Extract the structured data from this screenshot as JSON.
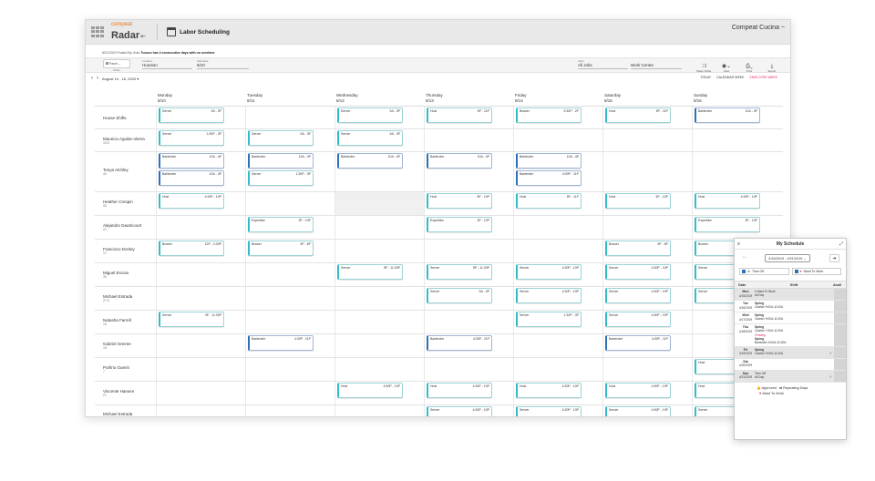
{
  "app": {
    "brand": "compeat",
    "product": "Radar",
    "page_title": "Labor Scheduling",
    "company": "Compeat Cucina ~"
  },
  "notice": {
    "prefix": "8/21/2020 Posted By: Auto",
    "text": "Tucson has 4 consecutive days with no overtime"
  },
  "filters": {
    "view_label": "Panel",
    "mode_label": "Mode",
    "location_label": "Location",
    "location_value": "Houston",
    "schedule_label": "Schedule",
    "schedule_value": "8/10",
    "jobs_label": "Jobs",
    "jobs_value": "All Jobs",
    "workcenter_value": "Work Center",
    "tools": [
      "Share Shifts",
      "View",
      "Print",
      "Export"
    ]
  },
  "datenav": {
    "range": "August 10 - 16, 2020",
    "today": "TODAY",
    "calendar_week": "CALENDAR WEEK",
    "employee_week": "EMPLOYEE WEEK"
  },
  "days": [
    {
      "name": "Monday",
      "date": "8/10"
    },
    {
      "name": "Tuesday",
      "date": "8/11"
    },
    {
      "name": "Wednesday",
      "date": "8/12"
    },
    {
      "name": "Thursday",
      "date": "8/13"
    },
    {
      "name": "Friday",
      "date": "8/14"
    },
    {
      "name": "Saturday",
      "date": "8/15"
    },
    {
      "name": "Sunday",
      "date": "8/16"
    }
  ],
  "rows": [
    {
      "name": "House Shifts",
      "sub": "",
      "h": 25,
      "cells": [
        [
          {
            "job": "Server",
            "time": "9A - 3P",
            "c": "teal"
          }
        ],
        [],
        [
          {
            "job": "Server",
            "time": "9A - 3P",
            "c": "teal"
          }
        ],
        [
          {
            "job": "Host",
            "time": "5P - 11P",
            "c": "teal"
          }
        ],
        [
          {
            "job": "Busser",
            "time": "5:30P - 2P",
            "c": "teal"
          }
        ],
        [
          {
            "job": "Host",
            "time": "5P - 11P",
            "c": "teal"
          }
        ],
        [
          {
            "job": "Bartender",
            "time": "10A - 4P",
            "c": "blue"
          }
        ]
      ]
    },
    {
      "name": "Mauricio Aguilar-olvera",
      "sub": "15.5",
      "h": 25,
      "cells": [
        [
          {
            "job": "Server",
            "time": "1:30P - 3P",
            "c": "teal"
          }
        ],
        [
          {
            "job": "Server",
            "time": "5A - 3P",
            "c": "teal"
          }
        ],
        [
          {
            "job": "Server",
            "time": "9A - 3P",
            "c": "teal"
          }
        ],
        [],
        [],
        [],
        []
      ]
    },
    {
      "name": "Tonya Atchley",
      "sub": "40",
      "h": 44,
      "cells": [
        [
          {
            "job": "Bartender",
            "time": "10A - 4P",
            "c": "blue"
          },
          {
            "job": "Bartender",
            "time": "10A - 4P",
            "c": "blue"
          }
        ],
        [
          {
            "job": "Bartender",
            "time": "10A - 4P",
            "c": "blue"
          },
          {
            "job": "Server",
            "time": "1:30P - 3P",
            "c": "teal"
          }
        ],
        [
          {
            "job": "Bartender",
            "time": "10A - 4P",
            "c": "blue"
          }
        ],
        [
          {
            "job": "Bartender",
            "time": "10A - 4P",
            "c": "blue"
          }
        ],
        [
          {
            "job": "Bartender",
            "time": "10A - 4P",
            "c": "blue"
          },
          {
            "job": "Bartender",
            "time": "4:00P - 11P",
            "c": "blue"
          }
        ],
        [],
        []
      ]
    },
    {
      "name": "Heather Crespin",
      "sub": "30",
      "h": 26,
      "cells": [
        [
          {
            "job": "Host",
            "time": "4:30P - 10P",
            "c": "teal"
          }
        ],
        [],
        [],
        [
          {
            "job": "Host",
            "time": "5P - 10P",
            "c": "teal"
          }
        ],
        [
          {
            "job": "Host",
            "time": "5P - 11P",
            "c": "teal"
          }
        ],
        [
          {
            "job": "Host",
            "time": "5P - 10P",
            "c": "teal"
          }
        ],
        [
          {
            "job": "Host",
            "time": "4:30P - 10P",
            "c": "teal"
          }
        ]
      ],
      "grey": [
        2
      ]
    },
    {
      "name": "Alejandro Dautricourt",
      "sub": "21",
      "h": 26,
      "cells": [
        [],
        [
          {
            "job": "Expeditor",
            "time": "3P - 10P",
            "c": "teal"
          }
        ],
        [],
        [
          {
            "job": "Expeditor",
            "time": "3P - 10P",
            "c": "teal"
          }
        ],
        [],
        [],
        [
          {
            "job": "Expeditor",
            "time": "3P - 10P",
            "c": "teal"
          }
        ]
      ]
    },
    {
      "name": "Francisco Donley",
      "sub": "17",
      "h": 26,
      "cells": [
        [
          {
            "job": "Busser",
            "time": "12P - 2:30P",
            "c": "teal"
          }
        ],
        [
          {
            "job": "Busser",
            "time": "3P - 6P",
            "c": "teal"
          }
        ],
        [],
        [],
        [],
        [
          {
            "job": "Busser",
            "time": "3P - 6P",
            "c": "teal"
          }
        ],
        [
          {
            "job": "Busser",
            "time": "",
            "c": "teal"
          }
        ]
      ]
    },
    {
      "name": "Miguel Escoto",
      "sub": "30",
      "h": 26,
      "cells": [
        [],
        [],
        [
          {
            "job": "Server",
            "time": "5P - 11:30P",
            "c": "teal"
          }
        ],
        [
          {
            "job": "Server",
            "time": "5P - 11:30P",
            "c": "teal"
          }
        ],
        [
          {
            "job": "Server",
            "time": "4:30P - 10P",
            "c": "teal"
          }
        ],
        [
          {
            "job": "Server",
            "time": "4:30P - 10P",
            "c": "teal"
          }
        ],
        [
          {
            "job": "Server",
            "time": "",
            "c": "teal"
          }
        ]
      ]
    },
    {
      "name": "Michael Estrada",
      "sub": "27.5",
      "h": 26,
      "cells": [
        [],
        [],
        [],
        [
          {
            "job": "Server",
            "time": "9A - 3P",
            "c": "teal"
          }
        ],
        [
          {
            "job": "Server",
            "time": "4:30P - 10P",
            "c": "teal"
          }
        ],
        [
          {
            "job": "Server",
            "time": "4:30P - 10P",
            "c": "teal"
          }
        ],
        [
          {
            "job": "Server",
            "time": "",
            "c": "teal"
          }
        ]
      ]
    },
    {
      "name": "Natasha Farrell",
      "sub": "16",
      "h": 26,
      "cells": [
        [
          {
            "job": "Server",
            "time": "3P - 11:30P",
            "c": "teal"
          }
        ],
        [],
        [],
        [],
        [
          {
            "job": "Server",
            "time": "1:30P - 3P",
            "c": "teal"
          }
        ],
        [
          {
            "job": "Server",
            "time": "4:30P - 10P",
            "c": "teal"
          }
        ],
        []
      ]
    },
    {
      "name": "Gabriel Greene",
      "sub": "19",
      "h": 26,
      "cells": [
        [],
        [
          {
            "job": "Bartender",
            "time": "4:30P - 11P",
            "c": "blue"
          }
        ],
        [],
        [
          {
            "job": "Bartender",
            "time": "4:30P - 11P",
            "c": "blue"
          }
        ],
        [],
        [
          {
            "job": "Bartender",
            "time": "4:30P - 11P",
            "c": "blue"
          }
        ],
        []
      ]
    },
    {
      "name": "Porfirio Guerin",
      "sub": "7",
      "h": 26,
      "cells": [
        [],
        [],
        [],
        [],
        [],
        [],
        [
          {
            "job": "Host",
            "time": "",
            "c": "teal"
          }
        ]
      ]
    },
    {
      "name": "Vincente Hansen",
      "sub": "27",
      "h": 26,
      "cells": [
        [],
        [],
        [
          {
            "job": "Host",
            "time": "4:30P - 10P",
            "c": "teal"
          }
        ],
        [
          {
            "job": "Host",
            "time": "4:30P - 10P",
            "c": "teal"
          }
        ],
        [
          {
            "job": "Host",
            "time": "4:30P - 10P",
            "c": "teal"
          }
        ],
        [
          {
            "job": "Host",
            "time": "4:30P - 10P",
            "c": "teal"
          }
        ],
        [
          {
            "job": "Host",
            "time": "",
            "c": "teal"
          }
        ]
      ]
    },
    {
      "name": "Michael Estrada",
      "sub": "",
      "h": 20,
      "cells": [
        [],
        [],
        [],
        [
          {
            "job": "Server",
            "time": "4:30P - 10P",
            "c": "teal"
          }
        ],
        [
          {
            "job": "Server",
            "time": "4:30P - 10P",
            "c": "teal"
          }
        ],
        [
          {
            "job": "Server",
            "time": "4:30P - 10P",
            "c": "teal"
          }
        ],
        [
          {
            "job": "Server",
            "time": "",
            "c": "teal"
          }
        ]
      ]
    }
  ],
  "panel": {
    "title": "My Schedule",
    "date_range": "4/15/2019 - 4/21/2019",
    "time_off": "Time Off",
    "want_to_work": "Want To Work",
    "col_date": "Date",
    "col_shift": "Shift",
    "col_avail": "Avail",
    "entries": [
      {
        "day": "Mon",
        "date": "4/15/2019",
        "lines": [
          "♥ Want To Work",
          "All Day"
        ]
      },
      {
        "day": "Tue",
        "date": "4/16/2019",
        "lines": [
          "Spring",
          "Cashier 9:00A-11:00A"
        ]
      },
      {
        "day": "Wed",
        "date": "4/17/2019",
        "lines": [
          "Spring",
          "Cashier 9:00A-11:00A"
        ]
      },
      {
        "day": "Thu",
        "date": "4/18/2019",
        "lines": [
          "Spring",
          "Cashier 7:00A-11:00A",
          "Pending",
          "Spring",
          "Bartender 6:00A-10:00A"
        ]
      },
      {
        "day": "Fri",
        "date": "4/19/2019",
        "lines": [
          "Spring",
          "Cashier 9:00A-11:00A"
        ]
      },
      {
        "day": "Sat",
        "date": "4/20/2019",
        "lines": []
      },
      {
        "day": "Sun",
        "date": "4/21/2019",
        "lines": [
          "Time Off",
          "All Day"
        ]
      }
    ],
    "legend_approved": "Approved",
    "legend_repeating": "Repeating Days",
    "legend_want": "Want To Work"
  }
}
